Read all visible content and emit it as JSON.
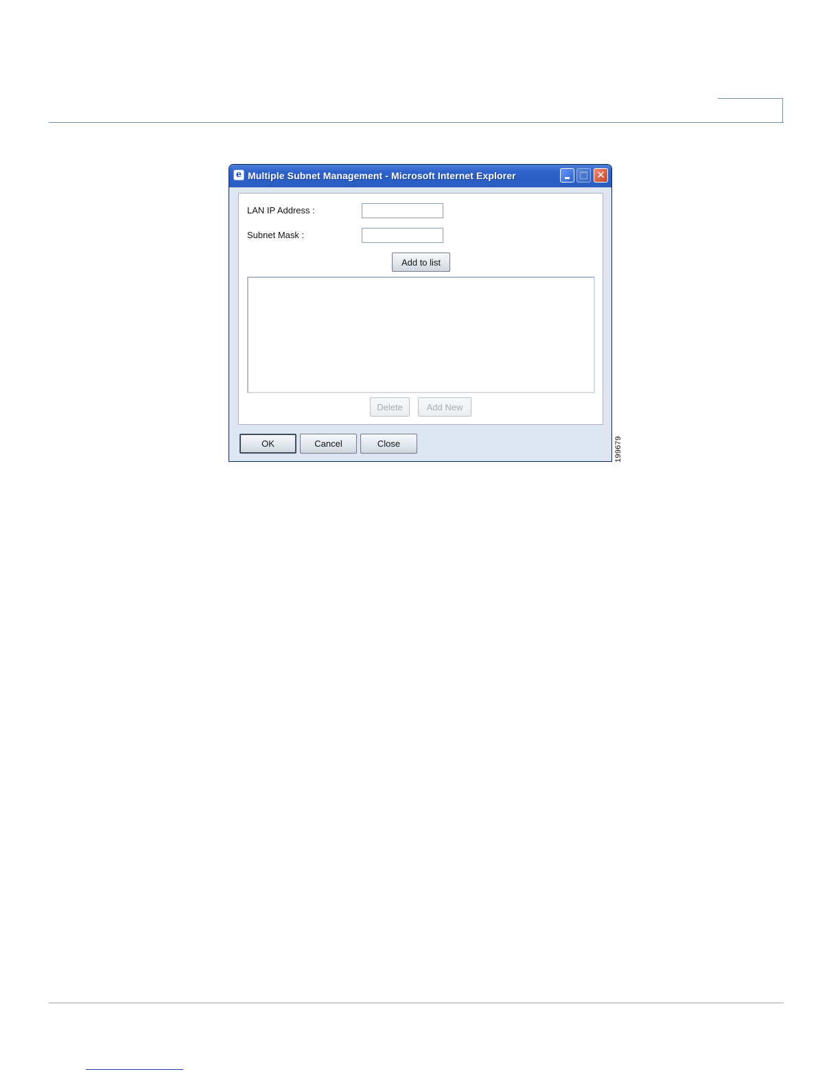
{
  "window": {
    "title": "Multiple Subnet Management - Microsoft Internet Explorer",
    "icon": "ie-icon",
    "controls": {
      "minimize": "minimize-icon",
      "maximize": "maximize-icon",
      "close": "close-icon"
    }
  },
  "form": {
    "lan_ip_label": "LAN IP Address :",
    "lan_ip_value": "",
    "subnet_mask_label": "Subnet Mask :",
    "subnet_mask_value": "",
    "add_to_list_label": "Add to list",
    "list_items": [],
    "delete_label": "Delete",
    "add_new_label": "Add New"
  },
  "footer_buttons": {
    "ok_label": "OK",
    "cancel_label": "Cancel",
    "close_label": "Close"
  },
  "figure_id": "199679",
  "colors": {
    "titlebar": "#2a5ec4",
    "window_body": "#dde6f2",
    "close_button": "#c8452a"
  }
}
